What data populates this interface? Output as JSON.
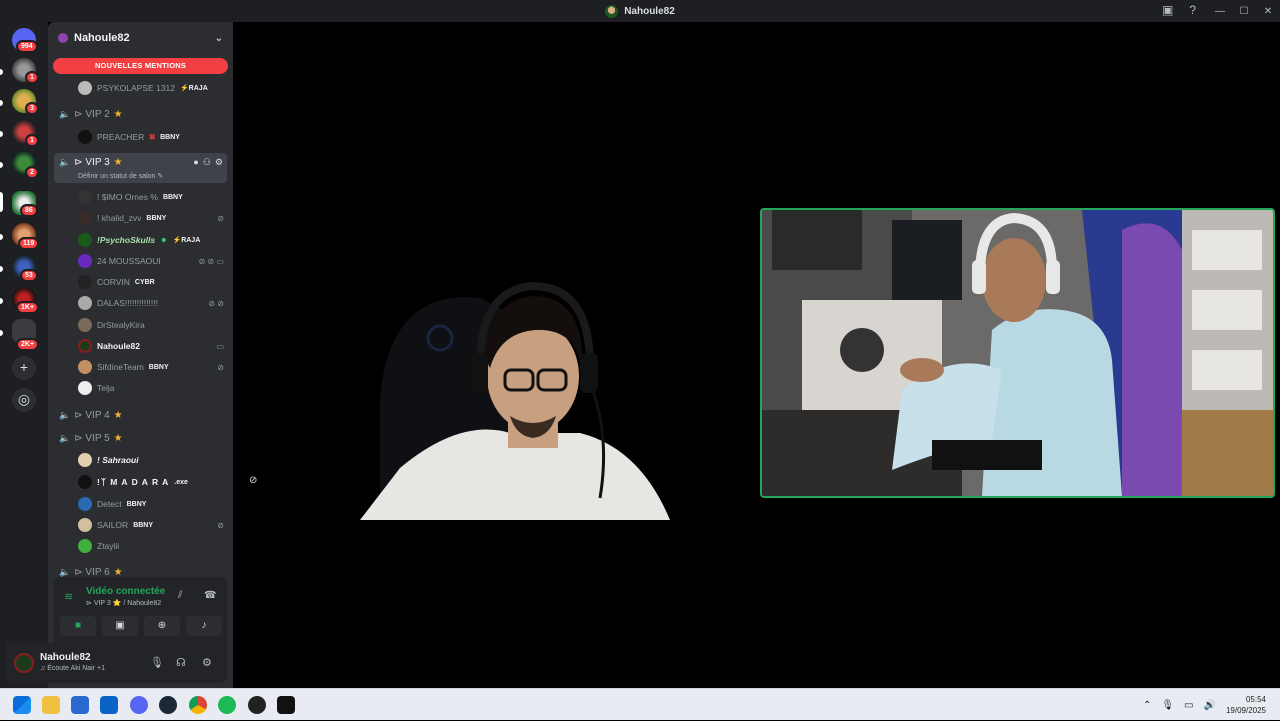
{
  "window": {
    "title": "Nahoule82",
    "controls": [
      "minimize",
      "maximize",
      "close"
    ]
  },
  "server_rail": {
    "items": [
      {
        "name": "discord-home",
        "badge": "994"
      },
      {
        "name": "server-1",
        "badge": "1"
      },
      {
        "name": "server-2",
        "badge": "3"
      },
      {
        "name": "server-3",
        "badge": "1"
      },
      {
        "name": "server-4",
        "badge": "2"
      },
      {
        "name": "server-5",
        "badge": "86"
      },
      {
        "name": "server-6",
        "badge": "119"
      },
      {
        "name": "server-7",
        "badge": "53"
      },
      {
        "name": "server-8",
        "badge": "1K+"
      },
      {
        "name": "server-9",
        "badge": "2K+"
      }
    ]
  },
  "sidebar": {
    "server_name": "Nahoule82",
    "mentions_label": "NOUVELLES MENTIONS",
    "top_user": {
      "name": "PSYKOLAPSE 1312",
      "tag": "⚡RAJA"
    },
    "channels": {
      "vip2": {
        "label": "VIP 2",
        "users": [
          {
            "name": "PREACHER",
            "tag": "BBNY"
          }
        ]
      },
      "vip3": {
        "label": "VIP 3",
        "status_hint": "Définir un statut de salon",
        "users": [
          {
            "name": "! $IMO Ornes %",
            "tag": "BBNY",
            "icons": ""
          },
          {
            "name": "! khalid_zvv",
            "tag": "BBNY",
            "icons": "⊘"
          },
          {
            "name": "!PsychoSkulls",
            "tag": "⚡RAJA",
            "icons": ""
          },
          {
            "name": "24 MOUSSAOUI",
            "tag": "",
            "icons": "⊘ ⊘ ▭"
          },
          {
            "name": "CORVIN",
            "tag": "CYBR",
            "icons": ""
          },
          {
            "name": "DALAS!!!!!!!!!!!!!!",
            "tag": "",
            "icons": "⊘ ⊘"
          },
          {
            "name": "DrStealyKira",
            "tag": "",
            "icons": ""
          },
          {
            "name": "Nahoule82",
            "tag": "",
            "icons": "▭"
          },
          {
            "name": "SifdineTeam",
            "tag": "BBNY",
            "icons": "⊘"
          },
          {
            "name": "Telja",
            "tag": "",
            "icons": ""
          }
        ]
      },
      "vip4": {
        "label": "VIP 4"
      },
      "vip5": {
        "label": "VIP 5",
        "users": [
          {
            "name": "! Sahraoui",
            "tag": "",
            "icons": ""
          },
          {
            "name": "!ᛉ M A D A R A",
            "tag": ".exe",
            "icons": ""
          },
          {
            "name": "Detect",
            "tag": "BBNY",
            "icons": ""
          },
          {
            "name": "SAILOR",
            "tag": "BBNY",
            "icons": "⊘"
          },
          {
            "name": "Ztaylii",
            "tag": "",
            "icons": ""
          }
        ]
      },
      "vip6": {
        "label": "VIP 6"
      }
    }
  },
  "voice": {
    "status": "Vidéo connectée",
    "location": "VIP 3 ⭐ / Nahoule82"
  },
  "user_panel": {
    "name": "Nahoule82",
    "activity": "Écoute Aki Nair +1"
  },
  "taskbar": {
    "time": "05:54",
    "date": "19/09/2025"
  },
  "colors": {
    "accent_green": "#23a55a",
    "mention_red": "#f23f42",
    "sidebar_bg": "#2b2d31",
    "rail_bg": "#1e1f22"
  }
}
